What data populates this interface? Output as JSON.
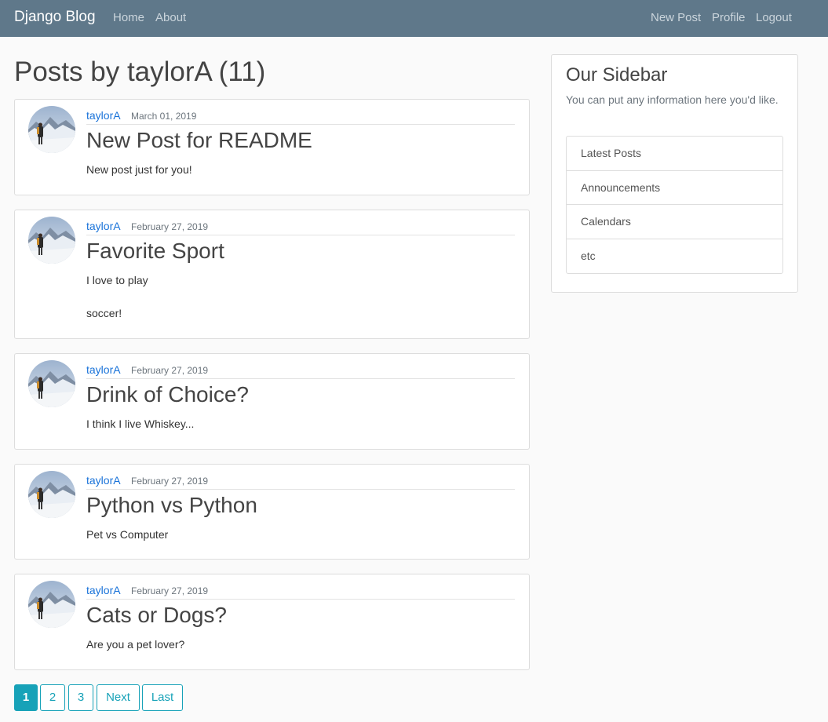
{
  "nav": {
    "brand": "Django Blog",
    "left_links": [
      "Home",
      "About"
    ],
    "right_links": [
      "New Post",
      "Profile",
      "Logout"
    ]
  },
  "page_title": "Posts by taylorA (11)",
  "posts": [
    {
      "author": "taylorA",
      "date": "March 01, 2019",
      "title": "New Post for README",
      "content": [
        "New post just for you!"
      ]
    },
    {
      "author": "taylorA",
      "date": "February 27, 2019",
      "title": "Favorite Sport",
      "content": [
        "I love to play",
        "soccer!"
      ]
    },
    {
      "author": "taylorA",
      "date": "February 27, 2019",
      "title": "Drink of Choice?",
      "content": [
        "I think I live Whiskey..."
      ]
    },
    {
      "author": "taylorA",
      "date": "February 27, 2019",
      "title": "Python vs Python",
      "content": [
        "Pet vs Computer"
      ]
    },
    {
      "author": "taylorA",
      "date": "February 27, 2019",
      "title": "Cats or Dogs?",
      "content": [
        "Are you a pet lover?"
      ]
    }
  ],
  "sidebar": {
    "title": "Our Sidebar",
    "text": "You can put any information here you'd like.",
    "items": [
      "Latest Posts",
      "Announcements",
      "Calendars",
      "etc"
    ]
  },
  "pagination": {
    "pages": [
      "1",
      "2",
      "3"
    ],
    "current": "1",
    "next_label": "Next",
    "last_label": "Last"
  },
  "colors": {
    "navbar": "#5f788a",
    "link": "#1a73d9",
    "pagination_accent": "#17a2b8"
  }
}
